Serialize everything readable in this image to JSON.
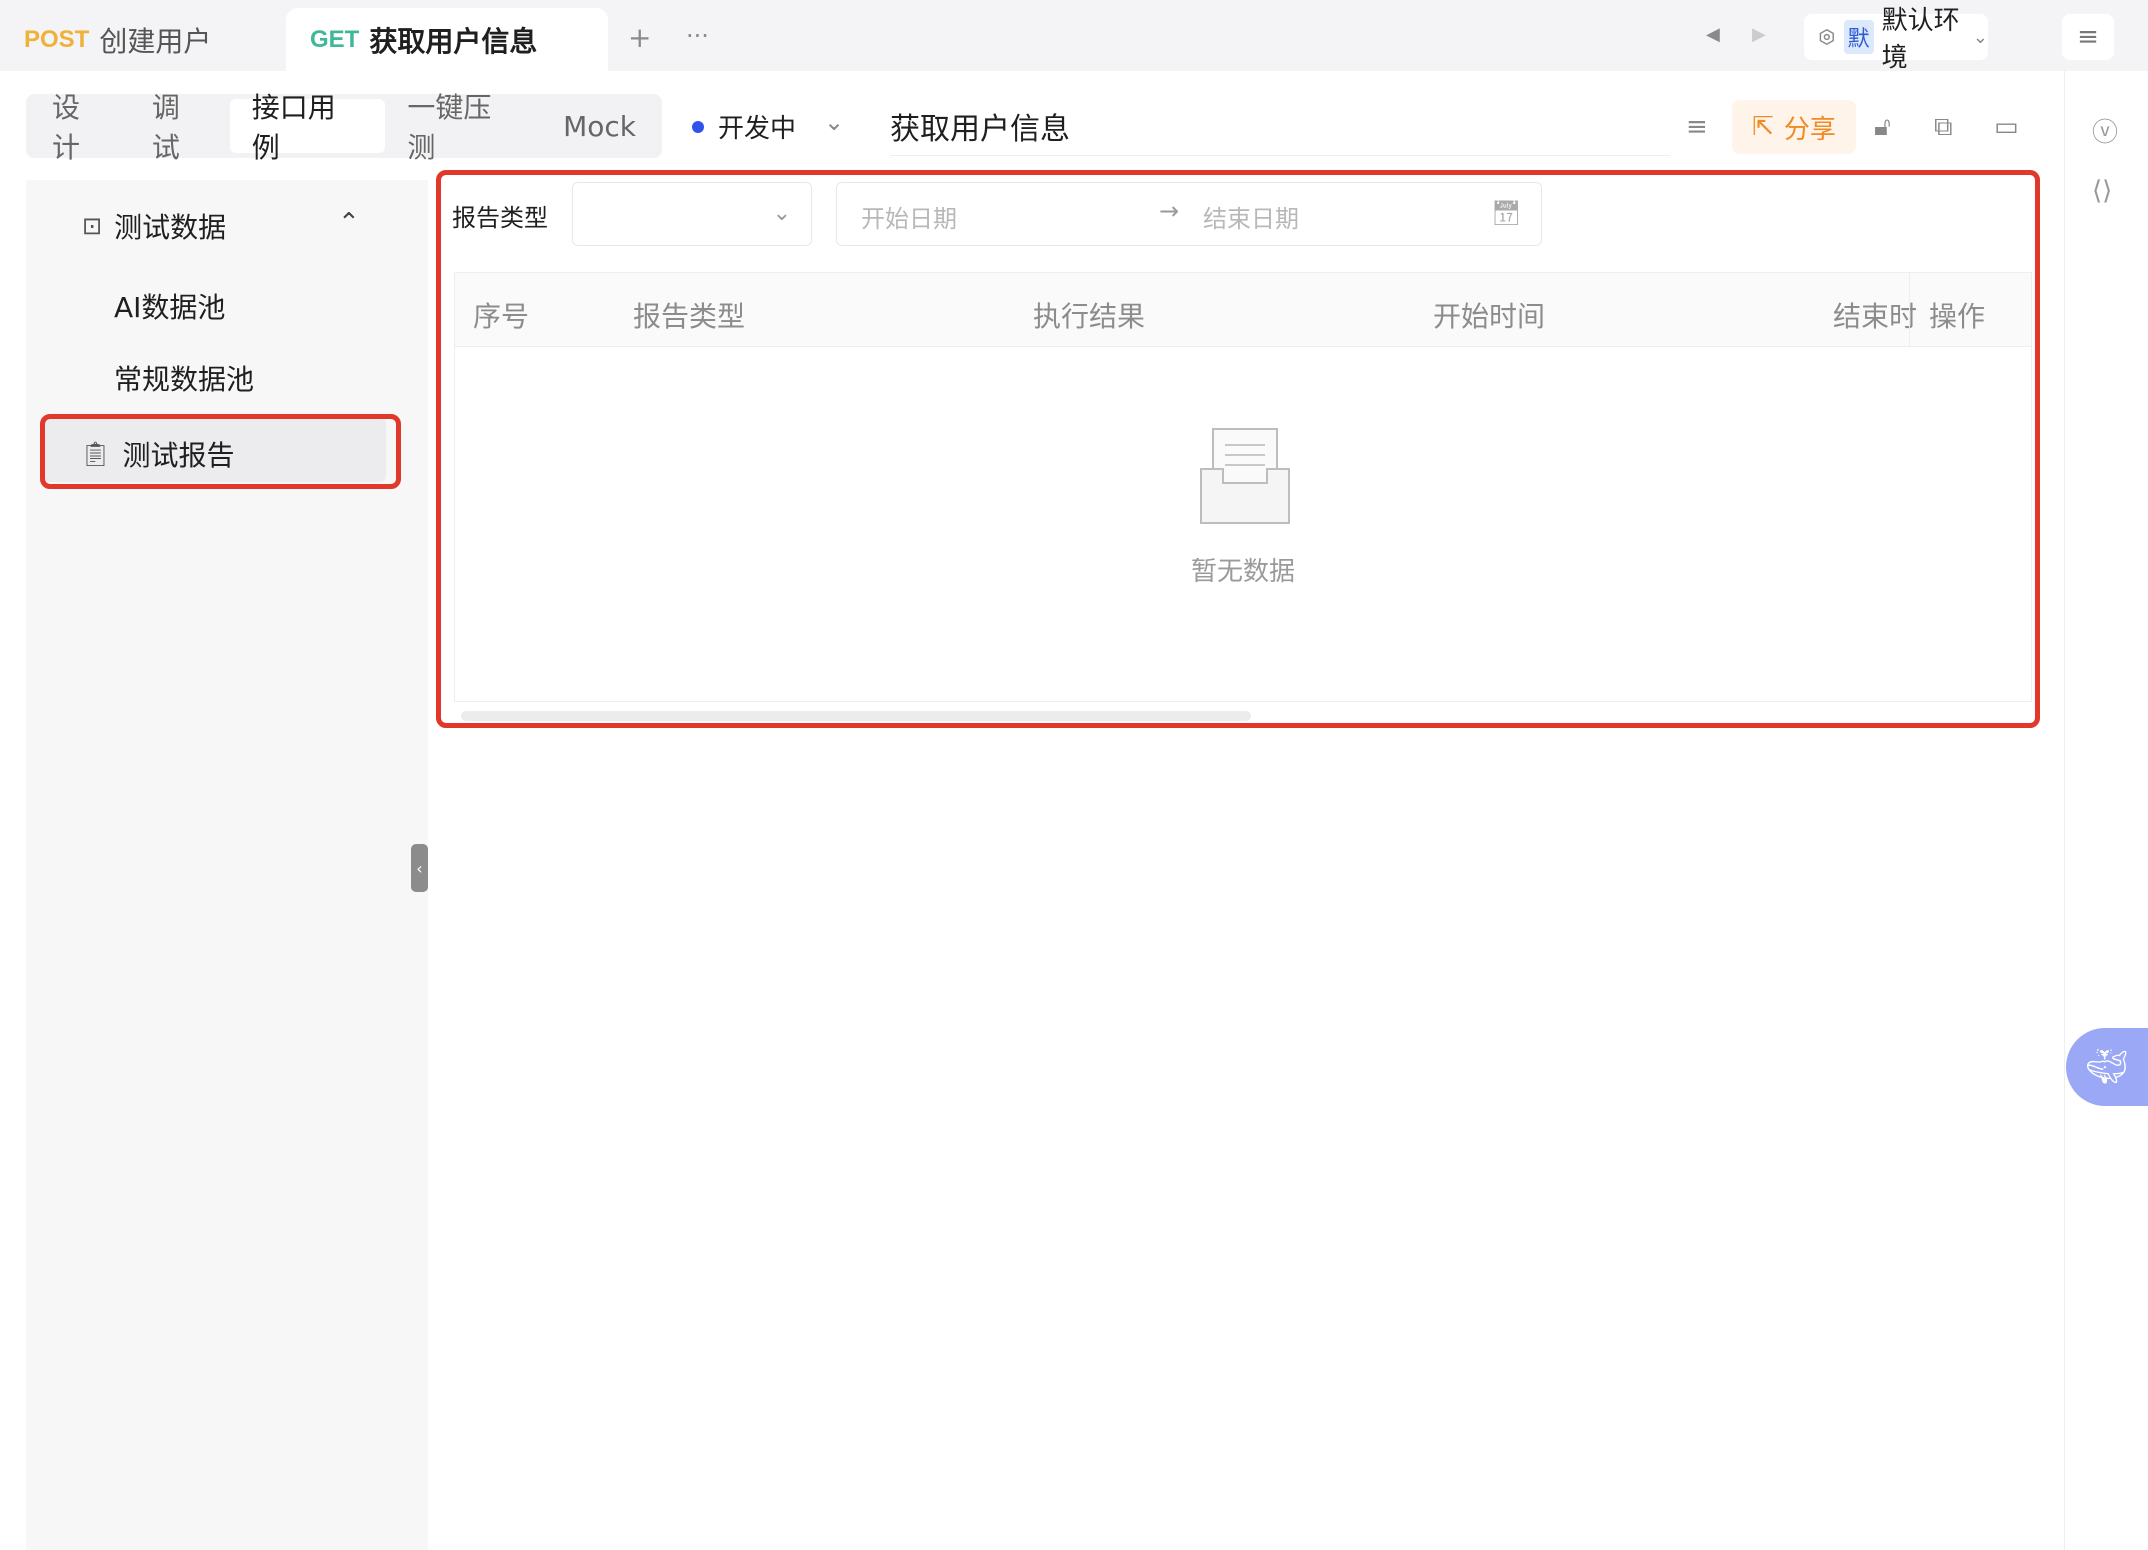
{
  "tabs": [
    {
      "method": "POST",
      "name": "创建用户"
    },
    {
      "method": "GET",
      "name": "获取用户信息"
    }
  ],
  "tabbar": {
    "add_icon": "+",
    "more_icon": "···"
  },
  "environment": {
    "badge": "默",
    "name": "默认环境"
  },
  "subtabs": [
    "设计",
    "调试",
    "接口用例",
    "一键压测",
    "Mock"
  ],
  "status": {
    "label": "开发中",
    "color": "#2f54eb"
  },
  "api_name": "获取用户信息",
  "share_label": "分享",
  "sidebar": {
    "groups": [
      {
        "label": "测试数据",
        "children": [
          "AI数据池",
          "常规数据池"
        ]
      }
    ],
    "report_label": "测试报告"
  },
  "filter": {
    "type_label": "报告类型",
    "start_placeholder": "开始日期",
    "end_placeholder": "结束日期",
    "range_arrow": "→"
  },
  "table": {
    "columns": [
      "序号",
      "报告类型",
      "执行结果",
      "开始时间",
      "结束时",
      "操作"
    ],
    "empty_text": "暂无数据"
  },
  "colors": {
    "accent_red": "#e1382c",
    "post": "#f0b13a",
    "get": "#3fb89a",
    "share": "#f08a24"
  }
}
